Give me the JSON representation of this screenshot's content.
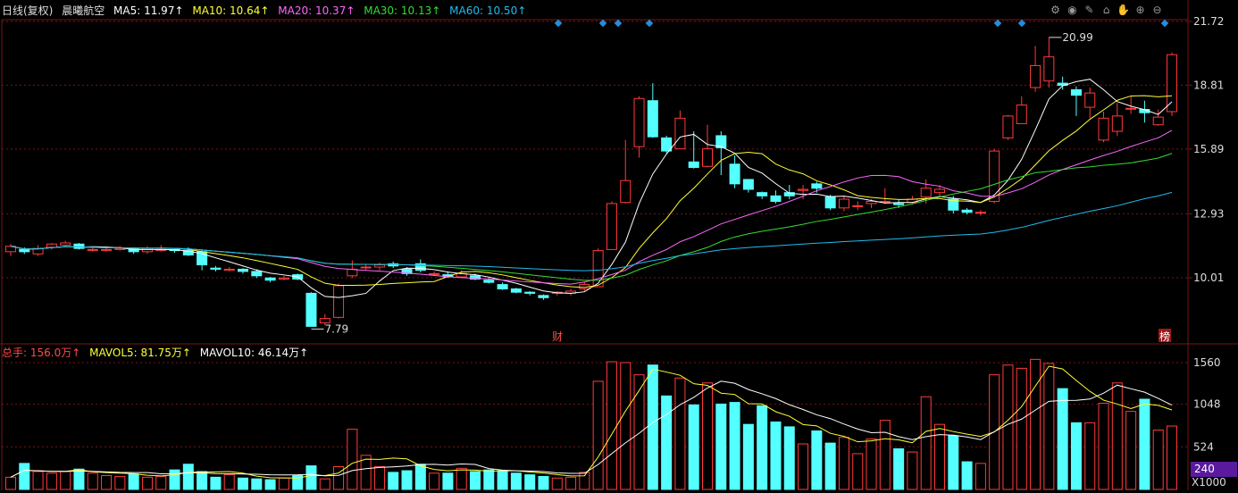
{
  "header": {
    "period": "日线(复权)",
    "stock_name": "晨曦航空",
    "ma5": "MA5: 11.97↑",
    "ma10": "MA10: 10.64↑",
    "ma20": "MA20: 10.37↑",
    "ma30": "MA30: 10.13↑",
    "ma60": "MA60: 10.50↑"
  },
  "volume_header": {
    "total": "总手: 156.0万↑",
    "mavol5": "MAVOL5: 81.75万↑",
    "mavol10": "MAVOL10: 46.14万↑"
  },
  "toolbar_icons": [
    "settings-icon",
    "eye-icon",
    "pen-icon",
    "store-icon",
    "hand-icon",
    "zoom-in-icon",
    "zoom-out-icon"
  ],
  "colors": {
    "up": "#ff3b3b",
    "down": "#54ffff",
    "ma5": "#ffffff",
    "ma10": "#ffff33",
    "ma20": "#ff66ff",
    "ma30": "#33dd33",
    "ma60": "#22bbee",
    "grid": "#7a1515",
    "marker": "#1f8fe0",
    "axis_text": "#dddddd"
  },
  "chart_data": {
    "type": "candlestick",
    "price_axis_ticks": [
      "21.72",
      "18.81",
      "15.89",
      "12.93",
      "10.01"
    ],
    "price_axis_values": [
      21.72,
      18.81,
      15.89,
      12.93,
      10.01
    ],
    "volume_axis_ticks": [
      "1560",
      "1048",
      "524",
      "240"
    ],
    "volume_axis_values": [
      1560,
      1048,
      524,
      240
    ],
    "volume_unit": "X1000",
    "annotations": {
      "high_label": "20.99",
      "low_label": "7.79",
      "event_cai": "财",
      "event_bang": "榜"
    },
    "candles": [
      [
        11.2,
        11.45,
        11.55,
        11.0,
        null,
        150
      ],
      [
        11.3,
        11.2,
        11.4,
        11.1,
        null,
        320
      ],
      [
        11.1,
        11.35,
        11.5,
        11.0,
        null,
        220
      ],
      [
        11.4,
        11.55,
        11.6,
        11.3,
        null,
        200
      ],
      [
        11.5,
        11.6,
        11.7,
        11.4,
        null,
        220
      ],
      [
        11.55,
        11.35,
        11.6,
        11.3,
        null,
        250
      ],
      [
        11.3,
        11.3,
        11.4,
        11.2,
        null,
        200
      ],
      [
        11.3,
        11.3,
        11.4,
        11.2,
        null,
        170
      ],
      [
        11.3,
        11.35,
        11.45,
        11.25,
        null,
        160
      ],
      [
        11.35,
        11.2,
        11.4,
        11.1,
        null,
        190
      ],
      [
        11.2,
        11.35,
        11.45,
        11.1,
        null,
        150
      ],
      [
        11.3,
        11.3,
        11.5,
        11.2,
        null,
        160
      ],
      [
        11.3,
        11.25,
        11.35,
        11.15,
        null,
        240
      ],
      [
        11.25,
        11.05,
        11.4,
        11.0,
        null,
        310
      ],
      [
        11.2,
        10.6,
        11.3,
        10.35,
        null,
        220
      ],
      [
        10.45,
        10.4,
        10.55,
        10.3,
        null,
        150
      ],
      [
        10.35,
        10.4,
        10.5,
        10.3,
        null,
        180
      ],
      [
        10.4,
        10.3,
        10.45,
        10.2,
        null,
        140
      ],
      [
        10.3,
        10.1,
        10.4,
        10.0,
        null,
        130
      ],
      [
        10.0,
        9.9,
        10.05,
        9.8,
        null,
        120
      ],
      [
        9.95,
        10.0,
        10.1,
        9.9,
        null,
        140
      ],
      [
        10.15,
        9.95,
        10.2,
        9.9,
        null,
        170
      ],
      [
        9.3,
        7.79,
        9.35,
        7.79,
        null,
        290
      ],
      [
        7.95,
        8.15,
        8.35,
        7.85,
        null,
        130
      ],
      [
        8.2,
        9.65,
        9.75,
        8.15,
        null,
        280
      ],
      [
        10.1,
        10.4,
        10.8,
        10.0,
        null,
        740
      ],
      [
        10.5,
        10.5,
        10.65,
        10.35,
        null,
        420
      ],
      [
        10.5,
        10.6,
        10.7,
        10.35,
        null,
        280
      ],
      [
        10.65,
        10.55,
        10.75,
        10.45,
        null,
        210
      ],
      [
        10.4,
        10.2,
        10.5,
        10.1,
        null,
        230
      ],
      [
        10.65,
        10.35,
        10.85,
        10.25,
        null,
        310
      ],
      [
        10.2,
        10.2,
        10.3,
        10.1,
        null,
        200
      ],
      [
        10.15,
        10.05,
        10.3,
        10.0,
        null,
        200
      ],
      [
        10.05,
        10.2,
        10.35,
        10.0,
        null,
        260
      ],
      [
        10.1,
        9.95,
        10.2,
        9.9,
        null,
        220
      ],
      [
        9.9,
        9.8,
        10.0,
        9.75,
        null,
        240
      ],
      [
        9.7,
        9.5,
        9.8,
        9.45,
        null,
        230
      ],
      [
        9.5,
        9.35,
        9.55,
        9.3,
        null,
        200
      ],
      [
        9.35,
        9.3,
        9.4,
        9.2,
        null,
        180
      ],
      [
        9.2,
        9.1,
        9.25,
        9.0,
        null,
        160
      ],
      [
        9.3,
        9.35,
        9.4,
        9.2,
        null,
        140
      ],
      [
        9.3,
        9.4,
        9.5,
        9.2,
        null,
        150
      ],
      [
        9.5,
        9.7,
        9.8,
        9.4,
        null,
        210
      ],
      [
        9.6,
        11.25,
        11.35,
        9.6,
        null,
        1330
      ],
      [
        11.3,
        13.4,
        13.5,
        11.3,
        null,
        1570
      ],
      [
        13.45,
        14.45,
        16.3,
        13.4,
        null,
        1560
      ],
      [
        16.0,
        18.2,
        18.3,
        15.5,
        null,
        1410
      ],
      [
        18.1,
        16.45,
        18.9,
        16.4,
        null,
        1530
      ],
      [
        16.4,
        15.8,
        16.5,
        15.7,
        null,
        1150
      ],
      [
        15.9,
        17.3,
        17.65,
        15.9,
        null,
        1370
      ],
      [
        15.3,
        15.05,
        16.7,
        15.0,
        null,
        1040
      ],
      [
        15.1,
        15.9,
        17.0,
        15.05,
        null,
        1310
      ],
      [
        16.5,
        15.95,
        16.7,
        14.7,
        null,
        1050
      ],
      [
        15.2,
        14.3,
        15.6,
        14.1,
        null,
        1070
      ],
      [
        14.5,
        14.05,
        14.5,
        13.9,
        null,
        800
      ],
      [
        13.9,
        13.75,
        13.95,
        13.6,
        null,
        1030
      ],
      [
        13.75,
        13.5,
        14.0,
        13.4,
        null,
        830
      ],
      [
        13.9,
        13.75,
        14.25,
        13.6,
        null,
        770
      ],
      [
        14.0,
        14.05,
        14.25,
        13.6,
        null,
        560
      ],
      [
        14.3,
        14.1,
        14.4,
        13.9,
        null,
        720
      ],
      [
        13.7,
        13.2,
        13.8,
        13.1,
        null,
        570
      ],
      [
        13.2,
        13.6,
        13.75,
        13.05,
        null,
        640
      ],
      [
        13.3,
        13.3,
        13.5,
        13.1,
        null,
        440
      ],
      [
        13.4,
        13.5,
        13.6,
        13.2,
        null,
        620
      ],
      [
        13.5,
        13.5,
        14.1,
        13.4,
        null,
        850
      ],
      [
        13.4,
        13.35,
        13.55,
        13.2,
        null,
        500
      ],
      [
        13.45,
        13.6,
        13.75,
        13.4,
        null,
        460
      ],
      [
        13.7,
        14.1,
        14.5,
        13.4,
        null,
        1140
      ],
      [
        13.9,
        14.05,
        14.25,
        13.7,
        null,
        800
      ],
      [
        13.6,
        13.1,
        13.75,
        12.95,
        null,
        660
      ],
      [
        13.1,
        13.0,
        13.2,
        12.9,
        null,
        340
      ],
      [
        13.0,
        13.0,
        13.1,
        12.85,
        null,
        320
      ],
      [
        13.5,
        15.8,
        15.9,
        13.4,
        null,
        1410
      ],
      [
        16.4,
        17.4,
        17.45,
        16.3,
        null,
        1530
      ],
      [
        17.05,
        17.9,
        18.3,
        17.05,
        null,
        1490
      ],
      [
        18.7,
        19.7,
        20.6,
        18.5,
        null,
        1600
      ],
      [
        19.0,
        20.1,
        20.99,
        18.7,
        null,
        1550
      ],
      [
        18.9,
        18.8,
        19.2,
        18.6,
        null,
        1240
      ],
      [
        18.6,
        18.35,
        18.75,
        17.4,
        null,
        820
      ],
      [
        17.8,
        18.45,
        18.7,
        17.3,
        null,
        820
      ],
      [
        16.3,
        17.3,
        17.6,
        16.2,
        null,
        1060
      ],
      [
        16.7,
        17.4,
        18.0,
        16.5,
        null,
        1310
      ],
      [
        17.75,
        17.75,
        18.3,
        17.5,
        null,
        960
      ],
      [
        17.7,
        17.55,
        18.1,
        17.1,
        null,
        1110
      ],
      [
        17.0,
        17.35,
        17.7,
        16.95,
        null,
        730
      ],
      [
        17.6,
        20.2,
        20.3,
        17.4,
        null,
        780
      ]
    ]
  }
}
